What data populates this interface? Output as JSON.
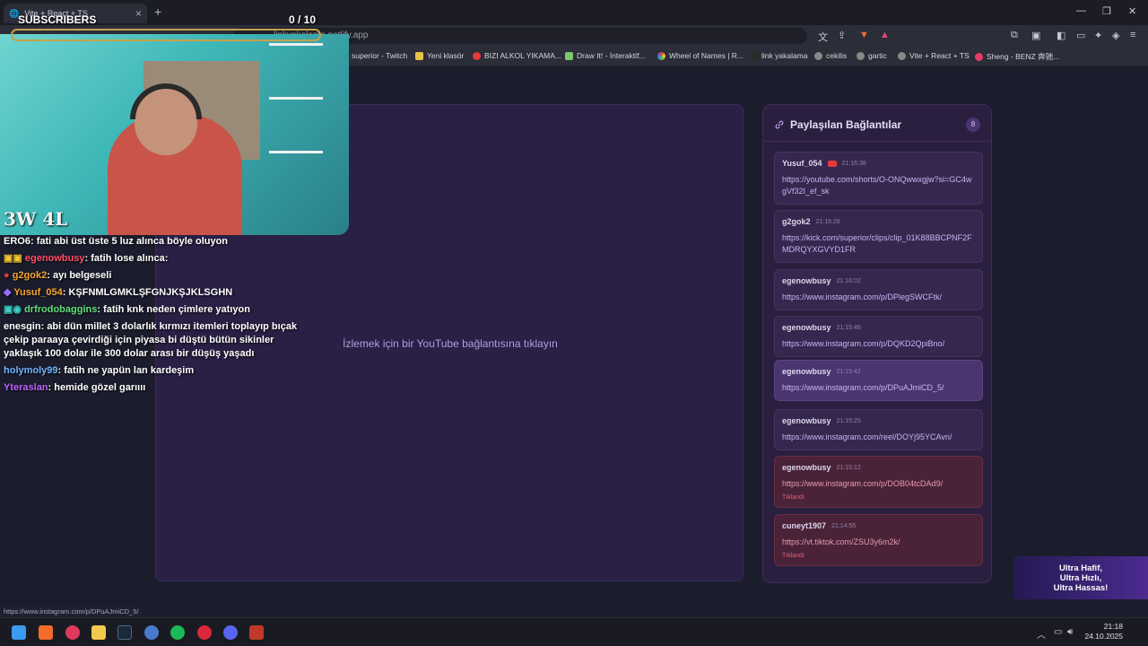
{
  "browser": {
    "tab_title": "Vite + React + TS",
    "url": "linkyakalama.netlify.app",
    "bookmarks": [
      "superior - Twitch",
      "Yeni klasör",
      "BIZI ALKOL YIKAMA...",
      "Draw It! - İnteraktif...",
      "Wheel of Names | R...",
      "link yakalama",
      "cekilis",
      "gartic",
      "Vite + React + TS",
      "Sheng - BENZ 奔驰..."
    ],
    "status_url": "https://www.instagram.com/p/DPuAJmiCD_5/"
  },
  "player": {
    "message": "İzlemek için bir YouTube bağlantısına tıklayın"
  },
  "panel": {
    "title": "Paylaşılan Bağlantılar",
    "count": "8",
    "links": [
      {
        "user": "Yusuf_054",
        "time": "21:16:38",
        "url": "https://youtube.com/shorts/O-ONQwwxgjw?si=GC4wgVf32I_ef_sk",
        "tag": ""
      },
      {
        "user": "g2gok2",
        "time": "21:16:28",
        "url": "https://kick.com/superior/clips/clip_01K88BBCPNF2FMDRQYXGVYD1FR",
        "tag": ""
      },
      {
        "user": "egenowbusy",
        "time": "21:16:02",
        "url": "https://www.instagram.com/p/DPlegSWCFtk/",
        "tag": ""
      },
      {
        "user": "egenowbusy",
        "time": "21:15:46",
        "url": "https://www.instagram.com/p/DQKD2QpiBno/",
        "tag": ""
      },
      {
        "user": "egenowbusy",
        "time": "21:15:42",
        "url": "https://www.instagram.com/p/DPuAJmiCD_5/",
        "tag": ""
      },
      {
        "user": "egenowbusy",
        "time": "21:15:25",
        "url": "https://www.instagram.com/reel/DOYj95YCAvn/",
        "tag": ""
      },
      {
        "user": "egenowbusy",
        "time": "21:15:12",
        "url": "https://www.instagram.com/p/DOB04tcDAd9/",
        "tag": "Tıklandı"
      },
      {
        "user": "cuneyt1907",
        "time": "21:14:55",
        "url": "https://vt.tiktok.com/ZSU3y6m2k/",
        "tag": "Tıklandı"
      }
    ]
  },
  "overlay": {
    "subscribers_label": "SUBSCRIBERS",
    "subscribers_count": "0  / 10",
    "logo_text": "3W 4L",
    "chat": [
      {
        "user": "ERO6",
        "user_color": "#ffffff",
        "text": "fati abi üst üste 5 luz alınca böyle oluyon"
      },
      {
        "user": "egenowbusy",
        "user_color": "#ff4f6a",
        "text": "fatih lose alınca:"
      },
      {
        "user": "g2gok2",
        "user_color": "#f7a531",
        "text": "ayı belgeseli"
      },
      {
        "user": "Yusuf_054",
        "user_color": "#f7a531",
        "text": "KŞFNMLGMKLŞFGNJKŞJKLSGHN"
      },
      {
        "user": "drfrodobaggins",
        "user_color": "#5fe07a",
        "text": "fatih knk neden çimlere yatıyon"
      },
      {
        "user": "enesgin",
        "user_color": "#ffffff",
        "text": "abi dün millet 3 dolarlık kırmızı itemleri toplayıp bıçak çekip paraaya çevirdiği için piyasa bi düştü bütün sikinler yaklaşık 100 dolar ile 300 dolar arası bir düşüş yaşadı"
      },
      {
        "user": "holymoly99",
        "user_color": "#6fb6ff",
        "text": "fatih ne yapün lan kardeşim"
      },
      {
        "user": "Yteraslan",
        "user_color": "#c061ff",
        "text": "hemide gözel garıııı"
      }
    ]
  },
  "ad": {
    "line1": "Ultra Hafif,",
    "line2": "Ultra Hızlı,",
    "line3": "Ultra Hassas!"
  },
  "taskbar": {
    "time": "21:18",
    "date": "24.10.2025"
  }
}
